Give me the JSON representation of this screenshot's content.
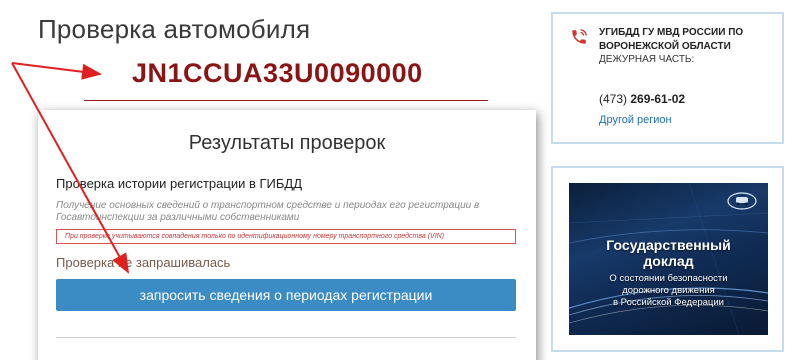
{
  "header": {
    "title": "Проверка автомобиля",
    "vin": "JN1CCUA33U0090000"
  },
  "results": {
    "title": "Результаты проверок",
    "check_title": "Проверка истории регистрации в ГИБДД",
    "check_description": "Получение основных сведений о транспортном средстве и периодах его регистрации в Госавтоинспекции за различными собственниками",
    "warning": "При проверке учитываются совпадения только по идентификационному номеру транспортного средства (VIN)",
    "status": "Проверка не запрашивалась",
    "request_button": "запросить сведения о периодах регистрации"
  },
  "gibdd": {
    "name": "УГИБДД ГУ МВД РОССИИ ПО ВОРОНЕЖСКОЙ ОБЛАСТИ",
    "duty_label": "ДЕЖУРНАЯ ЧАСТЬ:",
    "phone_code": "(473)",
    "phone_number": "269-61-02",
    "other_region": "Другой регион",
    "icon": "phone-icon"
  },
  "report": {
    "title_line1": "Государственный",
    "title_line2": "доклад",
    "subtitle_line1": "О состоянии безопасности",
    "subtitle_line2": "дорожного движения",
    "subtitle_line3": "в Российской Федерации"
  },
  "colors": {
    "vin": "#8b1414",
    "button": "#3b8bc4",
    "link": "#1f6fb2",
    "arrow": "#e02020",
    "warning": "#c83a3a",
    "card_border": "#c5dcec"
  }
}
